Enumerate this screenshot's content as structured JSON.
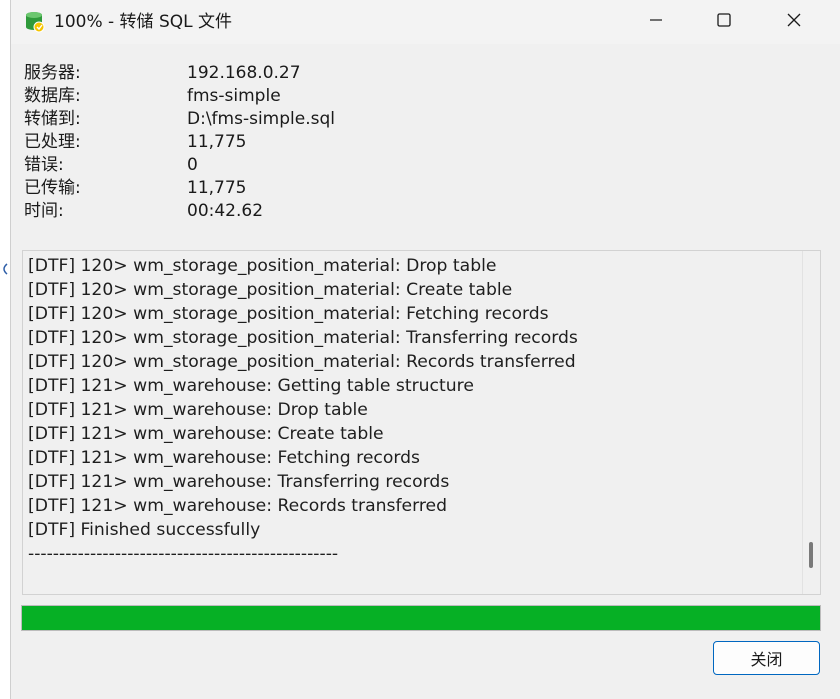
{
  "window": {
    "title": "100% - 转储 SQL 文件"
  },
  "info": {
    "rows": [
      {
        "label": "服务器:",
        "value": "192.168.0.27"
      },
      {
        "label": "数据库:",
        "value": "fms-simple"
      },
      {
        "label": "转储到:",
        "value": "D:\\fms-simple.sql"
      },
      {
        "label": "已处理:",
        "value": "11,775"
      },
      {
        "label": "错误:",
        "value": "0"
      },
      {
        "label": "已传输:",
        "value": "11,775"
      },
      {
        "label": "时间:",
        "value": "00:42.62"
      }
    ]
  },
  "log": {
    "lines": [
      "[DTF] 120> wm_storage_position_material: Drop table",
      "[DTF] 120> wm_storage_position_material: Create table",
      "[DTF] 120> wm_storage_position_material: Fetching records",
      "[DTF] 120> wm_storage_position_material: Transferring records",
      "[DTF] 120> wm_storage_position_material: Records transferred",
      "[DTF] 121> wm_warehouse: Getting table structure",
      "[DTF] 121> wm_warehouse: Drop table",
      "[DTF] 121> wm_warehouse: Create table",
      "[DTF] 121> wm_warehouse: Fetching records",
      "[DTF] 121> wm_warehouse: Transferring records",
      "[DTF] 121> wm_warehouse: Records transferred",
      "[DTF] Finished successfully",
      "--------------------------------------------------"
    ]
  },
  "progress": {
    "percent": 100,
    "color": "#06b025"
  },
  "buttons": {
    "close_label": "关闭"
  },
  "icons": {
    "app": "database-export-icon",
    "minimize": "minimize-icon",
    "maximize": "maximize-icon",
    "close": "close-icon"
  }
}
